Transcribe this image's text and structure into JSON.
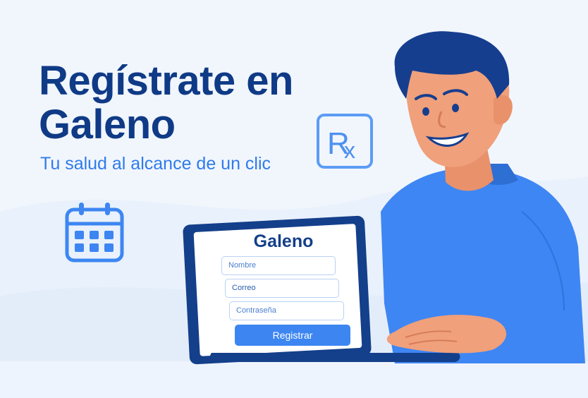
{
  "hero": {
    "title_line1": "Regístrate en",
    "title_line2": "Galeno",
    "subtitle": "Tu salud al alcance de un clic"
  },
  "icons": {
    "rx": "rx-prescription-icon",
    "calendar": "calendar-icon"
  },
  "form": {
    "brand": "Galeno",
    "name_placeholder": "Nombre",
    "email_placeholder": "Correo",
    "password_placeholder": "Contraseña",
    "submit_label": "Registrar"
  },
  "colors": {
    "primary_dark": "#0f3a86",
    "primary": "#3d86f2",
    "background": "#f1f6fd"
  }
}
